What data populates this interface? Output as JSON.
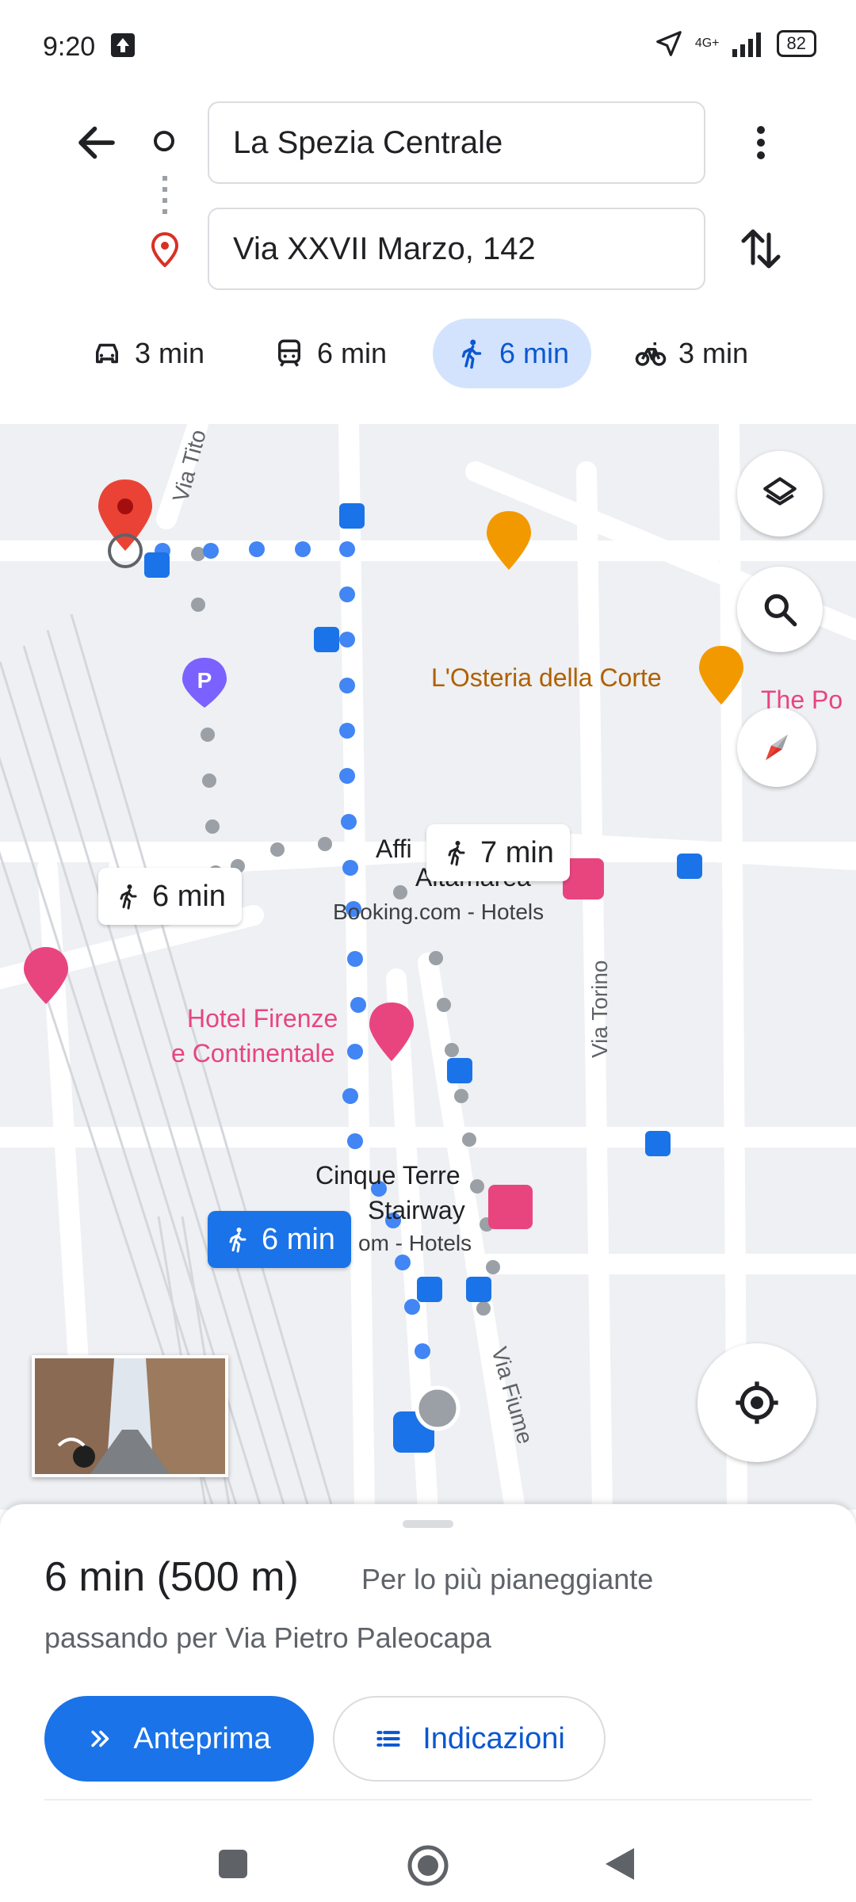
{
  "status_bar": {
    "time": "9:20",
    "network": "4G+",
    "battery": "82"
  },
  "route": {
    "origin": "La Spezia Centrale",
    "destination": "Via XXVII Marzo, 142"
  },
  "modes": [
    {
      "name": "car",
      "label": "3 min"
    },
    {
      "name": "transit",
      "label": "6 min"
    },
    {
      "name": "walk",
      "label": "6 min",
      "selected": true
    },
    {
      "name": "bike",
      "label": "3 min"
    }
  ],
  "map": {
    "streets": {
      "via_tito": "Via Tito",
      "via_torino": "Via Torino",
      "via_fiume": "Via Fiume"
    },
    "places": {
      "osteria": "L'Osteria della Corte",
      "the_po": "The Po",
      "affi": "Affi",
      "altamarea": "Altamarea",
      "booking": "Booking.com - Hotels",
      "hotel_firenze_1": "Hotel Firenze",
      "hotel_firenze_2": "e Continentale",
      "cinque_terre_1": "Cinque Terre",
      "cinque_terre_2": "Stairway",
      "booking2": "om - Hotels"
    },
    "chips": {
      "alt1": "6 min",
      "alt2": "7 min",
      "main": "6 min"
    }
  },
  "summary": {
    "time": "6 min (500 m)",
    "description": "Per lo più pianeggiante",
    "via": "passando per Via Pietro Paleocapa"
  },
  "buttons": {
    "preview": "Anteprima",
    "directions": "Indicazioni"
  },
  "colors": {
    "accent": "#1a73e8",
    "route_active": "#4285f4",
    "route_alt": "#9aa0a6",
    "hotel": "#e8457f",
    "food": "#f29900"
  }
}
